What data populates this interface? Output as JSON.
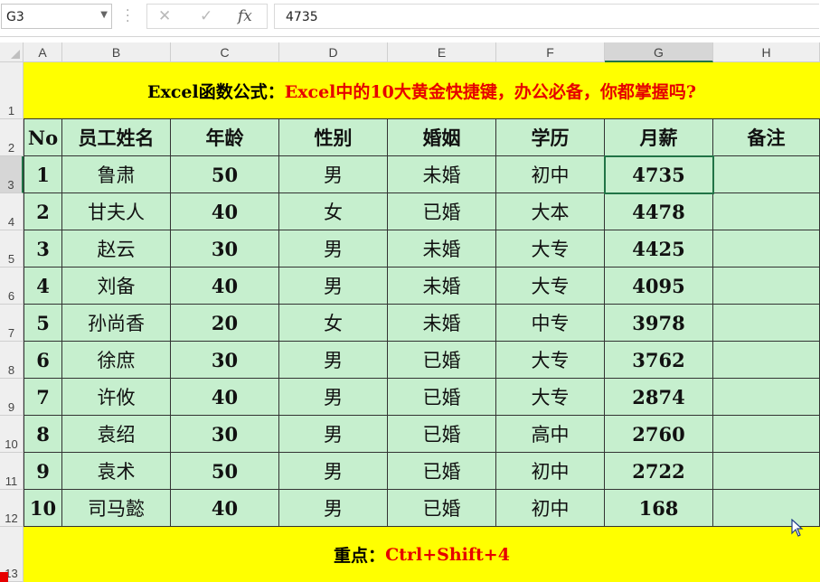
{
  "formula_bar": {
    "name_box": "G3",
    "formula": "4735",
    "icons": [
      "chevron-down-icon",
      "more-dots-icon",
      "cancel-icon",
      "enter-check-icon",
      "function-fx-icon"
    ]
  },
  "columns": [
    "A",
    "B",
    "C",
    "D",
    "E",
    "F",
    "G",
    "H"
  ],
  "rows": [
    "1",
    "2",
    "3",
    "4",
    "5",
    "6",
    "7",
    "8",
    "9",
    "10",
    "11",
    "12",
    "13"
  ],
  "title": {
    "prefix": "Excel函数公式：",
    "main": "Excel中的10大黄金快捷键，办公必备，你都掌握吗?"
  },
  "table": {
    "headers": [
      "No",
      "员工姓名",
      "年龄",
      "性别",
      "婚姻",
      "学历",
      "月薪",
      "备注"
    ],
    "rows": [
      [
        "1",
        "鲁肃",
        "50",
        "男",
        "未婚",
        "初中",
        "4735",
        ""
      ],
      [
        "2",
        "甘夫人",
        "40",
        "女",
        "已婚",
        "大本",
        "4478",
        ""
      ],
      [
        "3",
        "赵云",
        "30",
        "男",
        "未婚",
        "大专",
        "4425",
        ""
      ],
      [
        "4",
        "刘备",
        "40",
        "男",
        "未婚",
        "大专",
        "4095",
        ""
      ],
      [
        "5",
        "孙尚香",
        "20",
        "女",
        "未婚",
        "中专",
        "3978",
        ""
      ],
      [
        "6",
        "徐庶",
        "30",
        "男",
        "已婚",
        "大专",
        "3762",
        ""
      ],
      [
        "7",
        "许攸",
        "40",
        "男",
        "已婚",
        "大专",
        "2874",
        ""
      ],
      [
        "8",
        "袁绍",
        "30",
        "男",
        "已婚",
        "高中",
        "2760",
        ""
      ],
      [
        "9",
        "袁术",
        "50",
        "男",
        "已婚",
        "初中",
        "2722",
        ""
      ],
      [
        "10",
        "司马懿",
        "40",
        "男",
        "已婚",
        "初中",
        "168",
        ""
      ]
    ]
  },
  "tip": {
    "prefix": "重点：",
    "shortcut": "Ctrl+Shift+4"
  },
  "colors": {
    "yellow_fill": "#ffff00",
    "green_fill": "#c6efce",
    "red_text": "#e60000",
    "selection": "#217346"
  }
}
